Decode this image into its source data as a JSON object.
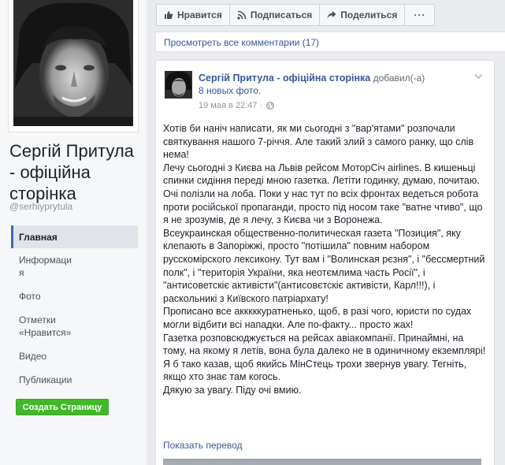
{
  "sidebar": {
    "page_name": "Сергій Притула - офіційна сторінка",
    "handle": "@serhiyprytula",
    "nav": [
      {
        "label": "Главная"
      },
      {
        "label": "Информаци я"
      },
      {
        "label": "Фото"
      },
      {
        "label": "Отметки «Нравится»"
      },
      {
        "label": "Видео"
      },
      {
        "label": "Публикации"
      }
    ],
    "create_page_label": "Создать Страницу"
  },
  "action_bar": {
    "like_label": "Нравится",
    "subscribe_label": "Подписаться",
    "share_label": "Поделиться",
    "more_label": "···"
  },
  "prev_post": {
    "view_comments": "Просмотреть все комментарии (17)"
  },
  "post": {
    "author": "Сергій Притула - офіційна сторінка",
    "action": "добавил(-а)",
    "photos_link": "8 новых фото.",
    "timestamp": "19 мая в 22:47 ·",
    "paragraphs": [
      "Хотів би наніч написати, як ми сьогодні з \"вар'ятами\" розпочали святкування нашого 7-річчя. Але такий злий з самого ранку, що слів нема!",
      "Лечу сьогодні з Києва на Львів рейсом МоторСіч airlines. В кишеньці спинки сидіння переді мною газетка. Летіти годинку, думаю, почитаю. Очі полізли на лоба. Поки у нас тут по всіх фронтах ведеться робота проти російської пропаганди, просто під носом таке \"ватне чтиво\", що я не зрозумів, де я лечу, з Києва чи з Воронежа.",
      "Всеукраинская общественно-политическая газета \"Позиция\", яку клепають в Запоріжжі, просто \"потішила\" повним набором русскомірского лексикону. Тут вам і \"Волинская рєзня\", і \"бессмертний полк\", і \"територія України, яка неотємлима часть Росії\", і \"антисоветскіє активісти\"(антисовєтскіє активісти, Карл!!!), і раскольникі з Київского патріархату!",
      "Прописано все акккккуратненько, щоб, в разі чого, юристи по судах могли відбити всі нападки. Але по-факту... просто жах!",
      "Газетка розповсюджується на рейсах авіакомпанії. Принаймні, на тому, на якому я летів, вона була далеко не в одиничному екземплярі!",
      "Я б тако казав, щоб якийсь МінСтець трохи звернув увагу. Тегніть, якщо хто знає там когось.",
      "Дякую за увагу. Піду очі вмию."
    ],
    "translate_link": "Показать перевод"
  },
  "icons": {
    "like": "thumbs-up-icon",
    "subscribe": "rss-icon",
    "share": "share-arrow-icon",
    "privacy": "globe-icon",
    "menu": "chevron-down-icon"
  },
  "colors": {
    "brand_blue": "#4267b2",
    "link_blue": "#365899",
    "create_green": "#42b72a",
    "page_bg": "#e9ebee"
  }
}
